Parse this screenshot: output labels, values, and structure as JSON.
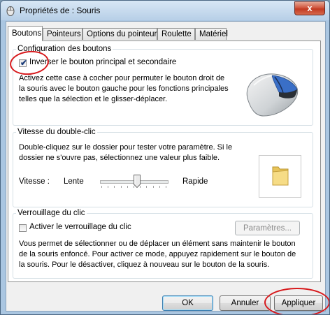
{
  "window": {
    "title": "Propriétés de : Souris",
    "close_label": "x"
  },
  "tabs": [
    {
      "label": "Boutons",
      "active": true
    },
    {
      "label": "Pointeurs",
      "active": false
    },
    {
      "label": "Options du pointeur",
      "active": false
    },
    {
      "label": "Roulette",
      "active": false
    },
    {
      "label": "Matériel",
      "active": false
    }
  ],
  "buttons_config": {
    "legend": "Configuration des boutons",
    "checkbox_label": "Inverser le bouton principal et secondaire",
    "checkbox_checked": true,
    "description_lines": [
      "Activez cette case à cocher pour permuter le bouton droit de",
      "la souris avec le bouton gauche pour les fonctions principales",
      "telles que la sélection et le glisser-déplacer."
    ]
  },
  "double_click": {
    "legend": "Vitesse du double-clic",
    "description_lines": [
      "Double-cliquez sur le dossier pour tester votre paramètre. Si le",
      "dossier ne s'ouvre pas, sélectionnez une valeur plus faible."
    ],
    "speed_label": "Vitesse :",
    "slow_label": "Lente",
    "fast_label": "Rapide",
    "speed_value_fraction": 0.55,
    "tick_count": 11
  },
  "click_lock": {
    "legend": "Verrouillage du clic",
    "checkbox_label": "Activer le verrouillage du clic",
    "checkbox_checked": false,
    "settings_button": "Paramètres...",
    "description_lines": [
      "Vous permet de sélectionner ou de déplacer un élément sans maintenir le bouton",
      "de la souris enfoncé. Pour activer ce mode, appuyez rapidement sur le bouton de",
      "la souris. Pour le désactiver, cliquez à nouveau sur le bouton de la souris."
    ]
  },
  "footer": {
    "ok": "OK",
    "cancel": "Annuler",
    "apply": "Appliquer"
  },
  "colors": {
    "annotation_red": "#d7191c",
    "titlebar": "#b7cfe7"
  }
}
